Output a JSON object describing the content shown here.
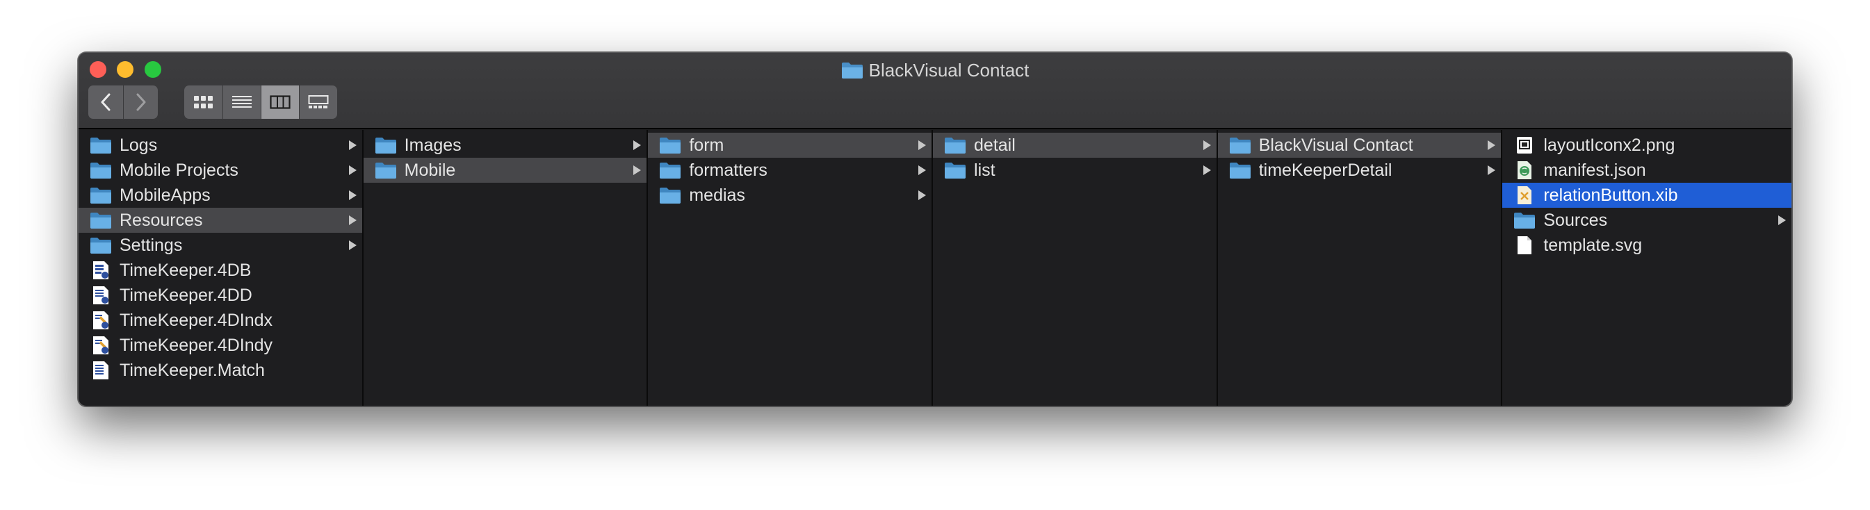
{
  "window": {
    "title": "BlackVisual Contact"
  },
  "columns": [
    {
      "items": [
        {
          "label": "Logs",
          "icon": "folder-icon",
          "has_children": true,
          "selected": false
        },
        {
          "label": "Mobile Projects",
          "icon": "folder-icon",
          "has_children": true,
          "selected": false
        },
        {
          "label": "MobileApps",
          "icon": "folder-icon",
          "has_children": true,
          "selected": false
        },
        {
          "label": "Resources",
          "icon": "folder-icon",
          "has_children": true,
          "selected": true
        },
        {
          "label": "Settings",
          "icon": "folder-icon",
          "has_children": true,
          "selected": false
        },
        {
          "label": "TimeKeeper.4DB",
          "icon": "4d-database-icon",
          "has_children": false,
          "selected": false
        },
        {
          "label": "TimeKeeper.4DD",
          "icon": "4d-data-icon",
          "has_children": false,
          "selected": false
        },
        {
          "label": "TimeKeeper.4DIndx",
          "icon": "4d-index-icon",
          "has_children": false,
          "selected": false
        },
        {
          "label": "TimeKeeper.4DIndy",
          "icon": "4d-index-icon",
          "has_children": false,
          "selected": false
        },
        {
          "label": "TimeKeeper.Match",
          "icon": "4d-match-icon",
          "has_children": false,
          "selected": false
        }
      ]
    },
    {
      "items": [
        {
          "label": "Images",
          "icon": "folder-icon",
          "has_children": true,
          "selected": false
        },
        {
          "label": "Mobile",
          "icon": "folder-icon",
          "has_children": true,
          "selected": true
        }
      ]
    },
    {
      "items": [
        {
          "label": "form",
          "icon": "folder-icon",
          "has_children": true,
          "selected": true
        },
        {
          "label": "formatters",
          "icon": "folder-icon",
          "has_children": true,
          "selected": false
        },
        {
          "label": "medias",
          "icon": "folder-icon",
          "has_children": true,
          "selected": false
        }
      ]
    },
    {
      "items": [
        {
          "label": "detail",
          "icon": "folder-icon",
          "has_children": true,
          "selected": true
        },
        {
          "label": "list",
          "icon": "folder-icon",
          "has_children": true,
          "selected": false
        }
      ]
    },
    {
      "items": [
        {
          "label": "BlackVisual Contact",
          "icon": "folder-icon",
          "has_children": true,
          "selected": true
        },
        {
          "label": "timeKeeperDetail",
          "icon": "folder-icon",
          "has_children": true,
          "selected": false
        }
      ]
    },
    {
      "items": [
        {
          "label": "layoutIconx2.png",
          "icon": "image-file-icon",
          "has_children": false,
          "selected": false
        },
        {
          "label": "manifest.json",
          "icon": "json-file-icon",
          "has_children": false,
          "selected": false
        },
        {
          "label": "relationButton.xib",
          "icon": "xib-file-icon",
          "has_children": false,
          "selected": true,
          "focused": true
        },
        {
          "label": "Sources",
          "icon": "folder-icon",
          "has_children": true,
          "selected": false
        },
        {
          "label": "template.svg",
          "icon": "document-icon",
          "has_children": false,
          "selected": false
        }
      ]
    }
  ],
  "colors": {
    "window_bg": "#1e1e20",
    "selection_focused": "#1f5ed6",
    "selection_unfocused": "#47474a",
    "folder": "#5aa6e0"
  }
}
